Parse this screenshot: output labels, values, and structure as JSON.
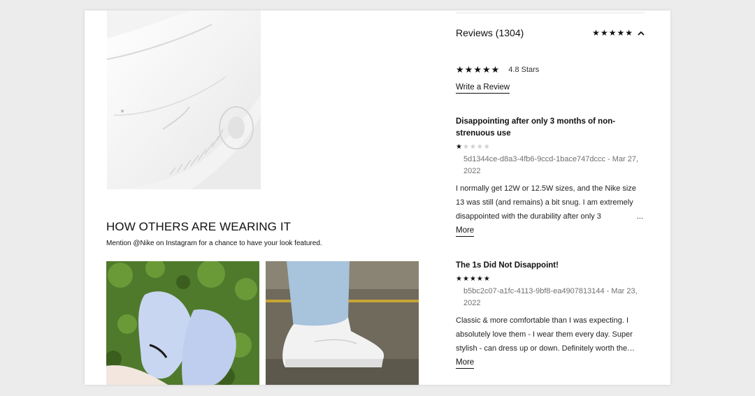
{
  "ugc": {
    "title": "HOW OTHERS ARE WEARING IT",
    "subtitle": "Mention @Nike on Instagram for a chance to have your look featured."
  },
  "reviews": {
    "header_title": "Reviews (1304)",
    "header_rating": 4.8,
    "summary_text": "4.8 Stars",
    "write_review_label": "Write a Review",
    "items": [
      {
        "title": "Disappointing after only 3 months of non-strenuous use",
        "rating": 1,
        "meta": "5d1344ce-d8a3-4fb6-9ccd-1bace747dccc - Mar 27, 2022",
        "body": "I normally get 12W or 12.5W sizes, and the Nike size 13 was still (and remains) a bit snug. I am extremely disappointed with the durability after only 3",
        "ellipsis": "...",
        "more_label": "More"
      },
      {
        "title": "The 1s Did Not Disappoint!",
        "rating": 5,
        "meta": "b5bc2c07-a1fc-4113-9bf8-ea4907813144 - Mar 23, 2022",
        "body": "Classic & more comfortable than I was expecting. I absolutely love them - I wear them every day. Super stylish - can dress up or down. Definitely worth the…",
        "more_label": "More"
      }
    ]
  },
  "icons": {
    "chevron": "chevron-up-icon",
    "star": "star-icon"
  },
  "colors": {
    "star_on": "#111111",
    "star_off": "#cfcfcf",
    "meta_text": "#707070"
  }
}
